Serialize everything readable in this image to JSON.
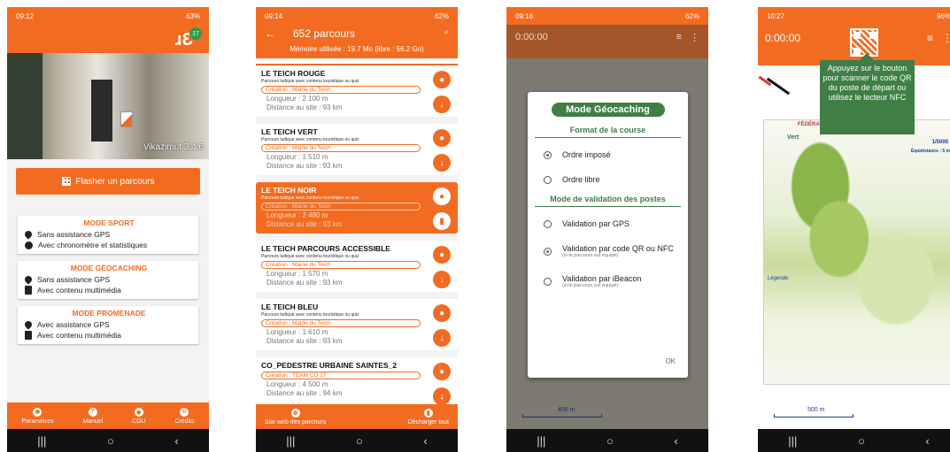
{
  "colors": {
    "accent": "#f26b21",
    "green": "#3f7f45"
  },
  "phone1": {
    "status_time": "09:12",
    "status_right": "63%",
    "badge": "17",
    "version": "Vikazimut 3.4.6",
    "flash_button": "Flasher un parcours",
    "modes": [
      {
        "title": "MODE SPORT",
        "lines": [
          "Sans assistance GPS",
          "Avec chronomètre et statistiques"
        ],
        "icons": [
          "gps-off-icon",
          "stopwatch-icon"
        ]
      },
      {
        "title": "MODE GÉOCACHING",
        "lines": [
          "Sans assistance GPS",
          "Avec contenu multimédia"
        ],
        "icons": [
          "gps-off-icon",
          "multimedia-book-icon"
        ]
      },
      {
        "title": "MODE PROMENADE",
        "lines": [
          "Avec assistance GPS",
          "Avec contenu multimédia"
        ],
        "icons": [
          "gps-pin-icon",
          "multimedia-book-icon"
        ]
      }
    ],
    "bottom_nav": [
      "Paramètres",
      "Manuel",
      "CGU",
      "Crédits"
    ]
  },
  "phone2": {
    "status_time": "09:14",
    "status_right": "62%",
    "title": "652 parcours",
    "memory": "Mémoire utilisée : 19.7 Mo (libre : 56.2 Go)",
    "items": [
      {
        "name": "LE TEICH ROUGE",
        "sub": "Parcours ludique avec contenu touristique ou quiz",
        "creation": "Création : Mairie du Teich",
        "length": "Longueur : 2 100 m",
        "distance": "Distance au site : 93 km"
      },
      {
        "name": "LE TEICH VERT",
        "sub": "Parcours ludique avec contenu touristique ou quiz",
        "creation": "Création : Mairie du Teich",
        "length": "Longueur : 1 510 m",
        "distance": "Distance au site : 93 km"
      },
      {
        "name": "LE TEICH NOIR",
        "sub": "Parcours ludique avec contenu touristique ou quiz",
        "creation": "Création : Mairie du Teich",
        "length": "Longueur : 2 480 m",
        "distance": "Distance au site : 93 km"
      },
      {
        "name": "LE TEICH PARCOURS ACCESSIBLE",
        "sub": "Parcours ludique avec contenu touristique ou quiz",
        "creation": "Création : Mairie du Teich",
        "length": "Longueur : 1 570 m",
        "distance": "Distance au site : 93 km"
      },
      {
        "name": "LE TEICH BLEU",
        "sub": "Parcours ludique avec contenu touristique ou quiz",
        "creation": "Création : Mairie du Teich",
        "length": "Longueur : 1 610 m",
        "distance": "Distance au site : 93 km"
      },
      {
        "name": "CO_PEDESTRE URBAINE SAINTES_2",
        "sub": "",
        "creation": "Création : TEAM CO 17",
        "length": "Longueur : 4 500 m",
        "distance": "Distance au site : 94 km"
      }
    ],
    "bottom_left": "Site web des parcours",
    "bottom_right": "Décharger tout"
  },
  "phone3": {
    "status_time": "09:16",
    "status_right": "62%",
    "timer": "0:00:00",
    "dialog_title": "Mode Géocaching",
    "section1": "Format de la course",
    "opt_order_imposed": "Ordre imposé",
    "opt_order_free": "Ordre libre",
    "section2": "Mode de validation des postes",
    "opt_gps": "Validation par GPS",
    "opt_qr": "Validation par code QR ou NFC",
    "opt_qr_note": "(si le parcours est équipé)",
    "opt_beacon": "Validation par iBeacon",
    "opt_beacon_note": "(si le parcours est équipé)",
    "ok": "OK",
    "scale": "400 m"
  },
  "phone4": {
    "status_time": "10:27",
    "status_right": "96%",
    "timer": "0:00:00",
    "tooltip": "Appuyez sur le bouton pour scanner le code QR du poste de départ ou utilisez le lecteur NFC",
    "map_header": "FÉDÉRATION",
    "map_green": "Vert",
    "map_scale_text": "1/5000",
    "map_equidistance": "Équidistance : 5 m",
    "map_legend": "Légende",
    "scale": "500 m"
  }
}
